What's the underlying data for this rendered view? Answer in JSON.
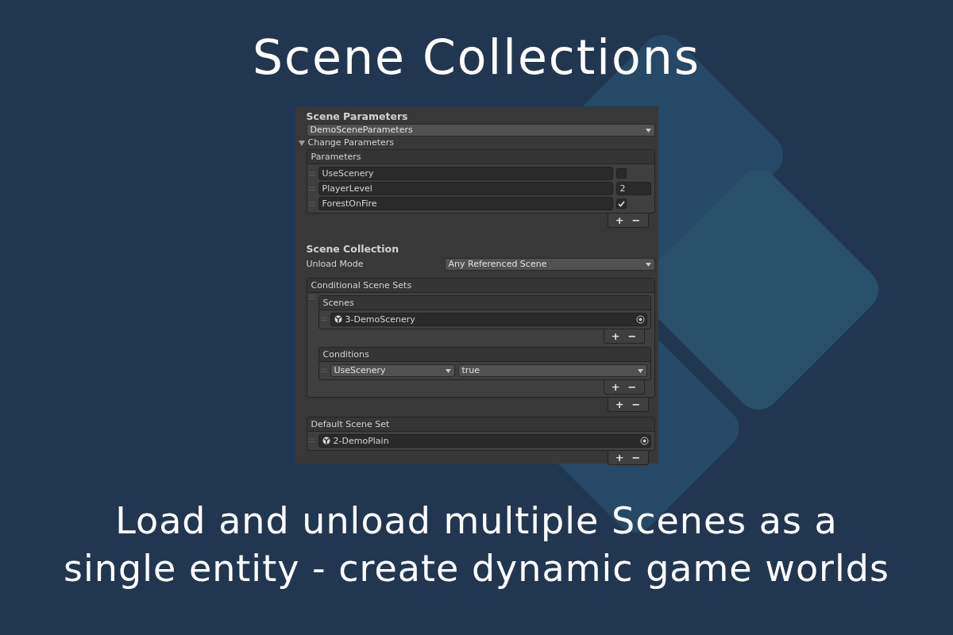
{
  "title": "Scene Collections",
  "inspector": {
    "parameters_section": {
      "heading": "Scene Parameters",
      "asset_dropdown": "DemoSceneParameters",
      "foldout": {
        "label": "Change Parameters",
        "expanded": true
      },
      "list": {
        "header": "Parameters",
        "items": [
          {
            "name": "UseScenery",
            "kind": "bool",
            "checked": false
          },
          {
            "name": "PlayerLevel",
            "kind": "int",
            "value": "2"
          },
          {
            "name": "ForestOnFire",
            "kind": "bool",
            "checked": true
          }
        ],
        "buttons": [
          "+",
          "−"
        ]
      }
    },
    "collection_section": {
      "heading": "Scene Collection",
      "unload_mode": {
        "label": "Unload Mode",
        "value": "Any Referenced Scene"
      },
      "conditional_sets": {
        "header": "Conditional Scene Sets",
        "sets": [
          {
            "scenes": {
              "header": "Scenes",
              "items": [
                "3-DemoScenery"
              ],
              "buttons": [
                "+",
                "−"
              ]
            },
            "conditions": {
              "header": "Conditions",
              "items": [
                {
                  "parameter": "UseScenery",
                  "value": "true"
                }
              ],
              "buttons": [
                "+",
                "−"
              ]
            }
          }
        ],
        "buttons": [
          "+",
          "−"
        ]
      },
      "default_set": {
        "header": "Default Scene Set",
        "items": [
          "2-DemoPlain"
        ],
        "buttons": [
          "+",
          "−"
        ]
      }
    }
  },
  "caption_lines": [
    "Load and unload multiple Scenes as a",
    "single entity - create dynamic game worlds"
  ]
}
